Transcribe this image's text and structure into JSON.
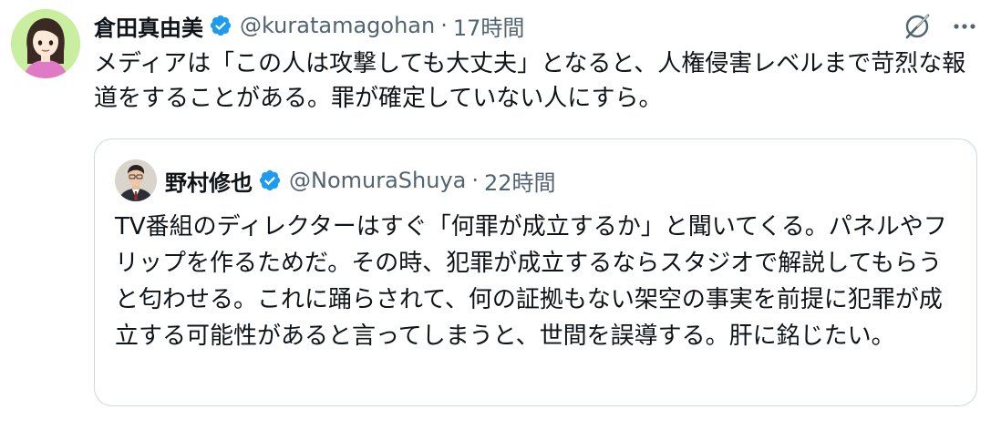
{
  "tweet": {
    "display_name": "倉田真由美",
    "handle": "@kuratamagohan",
    "separator": "·",
    "time": "17時間",
    "text": "メディアは「この人は攻撃しても大丈夫」となると、人権侵害レベルまで苛烈な報道をすることがある。罪が確定していない人にすら。"
  },
  "quote": {
    "display_name": "野村修也",
    "handle": "@NomuraShuya",
    "separator": "·",
    "time": "22時間",
    "text": "TV番組のディレクターはすぐ「何罪が成立するか」と聞いてくる。パネルやフリップを作るためだ。その時、犯罪が成立するならスタジオで解説してもらうと匂わせる。これに踊らされて、何の証拠もない架空の事実を前提に犯罪が成立する可能性があると言ってしまうと、世間を誤導する。肝に銘じたい。"
  },
  "icons": {
    "verified": "verified-badge-icon",
    "grok": "grok-icon",
    "more": "more-options-icon"
  },
  "colors": {
    "verified_blue": "#1d9bf0",
    "secondary_text": "#536471",
    "primary_text": "#0f1419",
    "border": "#cfd9de"
  }
}
